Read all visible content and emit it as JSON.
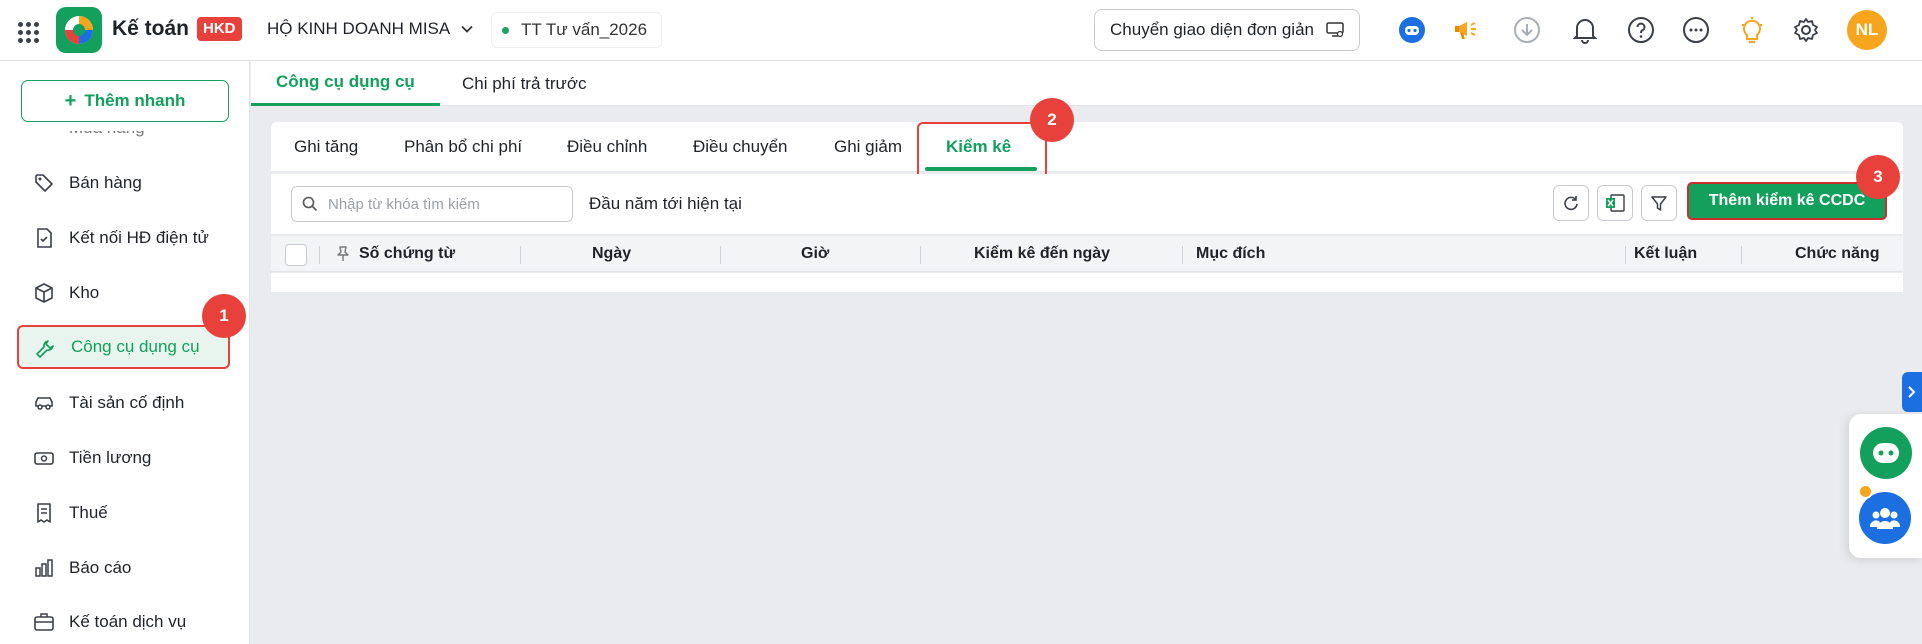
{
  "header": {
    "app_name": "Kế toán",
    "badge": "HKD",
    "company": "HỘ KINH DOANH MISA",
    "branch": "TT Tư vấn_2026",
    "switch_ui_label": "Chuyển giao diện đơn giản",
    "user_initials": "NL",
    "icons": [
      "apps-grid-icon",
      "robot-assistant-icon",
      "megaphone-icon",
      "download-icon",
      "bell-icon",
      "help-icon",
      "more-icon",
      "lightbulb-icon",
      "gear-icon"
    ]
  },
  "sidebar": {
    "quick_add": "Thêm nhanh",
    "partial_item": "Mua hàng",
    "items": [
      {
        "label": "Bán hàng",
        "icon": "tag-icon"
      },
      {
        "label": "Kết nối HĐ điện tử",
        "icon": "invoice-icon"
      },
      {
        "label": "Kho",
        "icon": "box-icon"
      },
      {
        "label": "Công cụ dụng cụ",
        "icon": "wrench-icon"
      },
      {
        "label": "Tài sản cố định",
        "icon": "car-icon"
      },
      {
        "label": "Tiền lương",
        "icon": "money-icon"
      },
      {
        "label": "Thuế",
        "icon": "receipt-icon"
      },
      {
        "label": "Báo cáo",
        "icon": "bar-chart-icon"
      },
      {
        "label": "Kế toán dịch vụ",
        "icon": "briefcase-icon"
      }
    ]
  },
  "main_tabs": [
    "Công cụ dụng cụ",
    "Chi phí trả trước"
  ],
  "sub_tabs": [
    "Ghi tăng",
    "Phân bổ chi phí",
    "Điều chỉnh",
    "Điều chuyển",
    "Ghi giảm",
    "Kiểm kê"
  ],
  "toolbar": {
    "search_placeholder": "Nhập từ khóa tìm kiếm",
    "period": "Đầu năm tới hiện tại",
    "add_button": "Thêm kiểm kê CCDC"
  },
  "table": {
    "columns": [
      "Số chứng từ",
      "Ngày",
      "Giờ",
      "Kiểm kê đến ngày",
      "Mục đích",
      "Kết luận",
      "Chức năng"
    ]
  },
  "steps": [
    "1",
    "2",
    "3"
  ],
  "colors": {
    "primary": "#12a05c",
    "highlight": "#e8413c",
    "accent_blue": "#1b6fe0",
    "avatar": "#f7a51c"
  }
}
